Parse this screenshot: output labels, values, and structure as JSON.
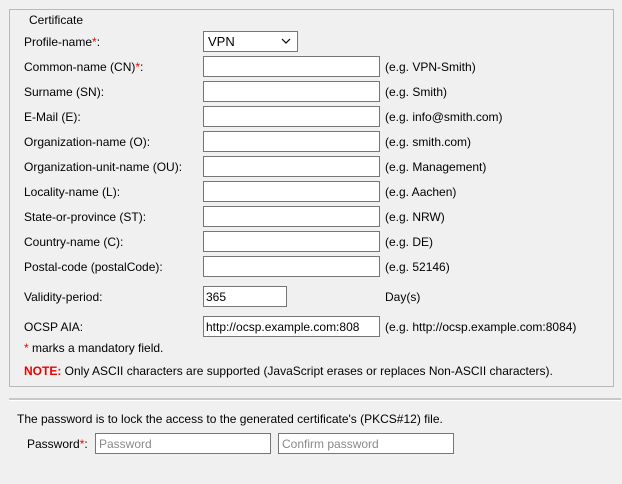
{
  "certificate": {
    "legend": "Certificate",
    "profile": {
      "label": "Profile-name",
      "required_mark": "*",
      "suffix": ":",
      "selected": "VPN"
    },
    "fields": [
      {
        "label": "Common-name (CN)",
        "required": true,
        "value": "",
        "hint": "(e.g. VPN-Smith)"
      },
      {
        "label": "Surname (SN):",
        "required": false,
        "value": "",
        "hint": "(e.g. Smith)"
      },
      {
        "label": "E-Mail (E):",
        "required": false,
        "value": "",
        "hint": "(e.g. info@smith.com)"
      },
      {
        "label": "Organization-name (O):",
        "required": false,
        "value": "",
        "hint": "(e.g. smith.com)"
      },
      {
        "label": "Organization-unit-name (OU):",
        "required": false,
        "value": "",
        "hint": "(e.g. Management)"
      },
      {
        "label": "Locality-name (L):",
        "required": false,
        "value": "",
        "hint": "(e.g. Aachen)"
      },
      {
        "label": "State-or-province (ST):",
        "required": false,
        "value": "",
        "hint": "(e.g. NRW)"
      },
      {
        "label": "Country-name (C):",
        "required": false,
        "value": "",
        "hint": "(e.g. DE)"
      },
      {
        "label": "Postal-code (postalCode):",
        "required": false,
        "value": "",
        "hint": "(e.g. 52146)"
      },
      {
        "label": "Validity-period:",
        "required": false,
        "value": "365",
        "hint": "Day(s)"
      },
      {
        "label": "OCSP AIA:",
        "required": false,
        "value": "http://ocsp.example.com:808",
        "hint": "(e.g. http://ocsp.example.com:8084)"
      }
    ],
    "mandatory_note": {
      "mark": "*",
      "text": " marks a mandatory field."
    },
    "note": {
      "tag": "NOTE:",
      "text": " Only ASCII characters are supported (JavaScript erases or replaces Non-ASCII characters)."
    }
  },
  "password": {
    "description": "The password is to lock the access to the generated certificate's (PKCS#12) file.",
    "label": "Password",
    "required_mark": "*",
    "suffix": ":",
    "placeholder": "Password",
    "confirm_placeholder": "Confirm password",
    "value": "",
    "confirm_value": ""
  },
  "colors": {
    "required": "#e00000",
    "border": "#767676",
    "background": "#f0f0f0"
  },
  "icons": {
    "select": "chevron-down-icon"
  }
}
